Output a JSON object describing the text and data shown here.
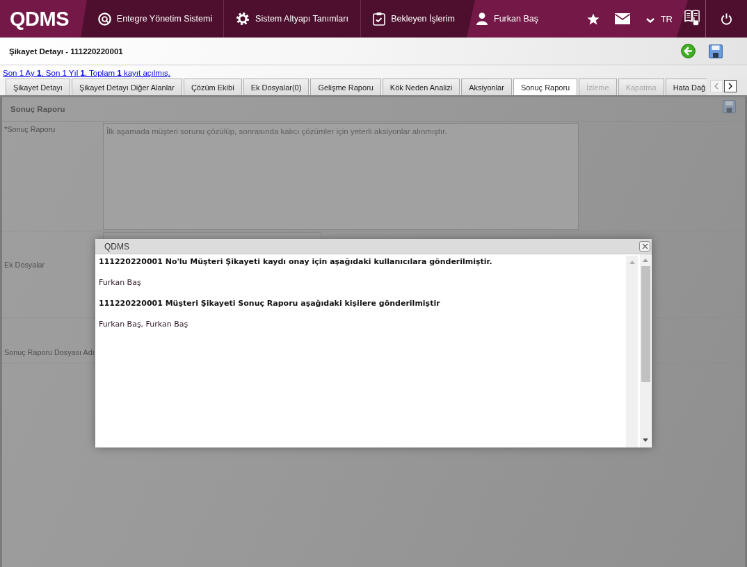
{
  "top_bar": {
    "logo": "QDMS",
    "menu": [
      {
        "kind": "modules",
        "label": "Entegre Yönetim Sistemi"
      },
      {
        "kind": "settings",
        "label": "Sistem Altyapı Tanımları"
      },
      {
        "kind": "tasks",
        "label": "Bekleyen İşlerim"
      }
    ],
    "user": "Furkan Baş",
    "language": "TR"
  },
  "page_header": {
    "title": "Şikayet Detayı - 111220220001"
  },
  "record_summary": "Son 1 Ay **1**, Son 1 Yıl **1**, Toplam **1** kayıt açılmış.",
  "tabs": [
    {
      "label": "Şikayet Detayı",
      "selected": false,
      "disabled": false
    },
    {
      "label": "Şikayet Detayı Diğer Alanlar",
      "selected": false,
      "disabled": false
    },
    {
      "label": "Çözüm Ekibi",
      "selected": false,
      "disabled": false
    },
    {
      "label": "Ek Dosyalar(0)",
      "selected": false,
      "disabled": false
    },
    {
      "label": "Gelişme Raporu",
      "selected": false,
      "disabled": false
    },
    {
      "label": "Kök Neden Analizi",
      "selected": false,
      "disabled": false
    },
    {
      "label": "Aksiyonlar",
      "selected": false,
      "disabled": false
    },
    {
      "label": "Sonuç Raporu",
      "selected": true,
      "disabled": false
    },
    {
      "label": "İzleme",
      "selected": false,
      "disabled": true
    },
    {
      "label": "Kapatma",
      "selected": false,
      "disabled": true
    },
    {
      "label": "Hata Dağ",
      "selected": false,
      "disabled": false
    }
  ],
  "tab_scroller": {
    "back_disabled": true,
    "forward_disabled": false
  },
  "section": {
    "title": "Sonuç Raporu",
    "fields": [
      {
        "kind": "textarea",
        "label": "*Sonuç Raporu",
        "value": "İlk aşamada müşteri sorunu çözülüp, sonrasında kalıcı çözümler için yeterli aksiyonlar alınmıştır."
      },
      {
        "kind": "upload",
        "label": "Ek Dosyalar"
      },
      {
        "kind": "label",
        "label": "Sonuç Raporu Dosyası Adı"
      }
    ]
  },
  "dialog": {
    "title": "QDMS",
    "lines": [
      {
        "kind": "heading",
        "text": "111220220001 No'lu Müşteri Şikayeti kaydı onay için aşağıdaki kullanıcılara gönderilmiştir."
      },
      {
        "kind": "text",
        "text": "Furkan Baş"
      },
      {
        "kind": "heading",
        "text": "111220220001 Müşteri Şikayeti Sonuç Raporu aşağıdaki kişilere gönderilmiştir"
      },
      {
        "kind": "text",
        "text": "Furkan Baş, Furkan Baş"
      }
    ]
  }
}
